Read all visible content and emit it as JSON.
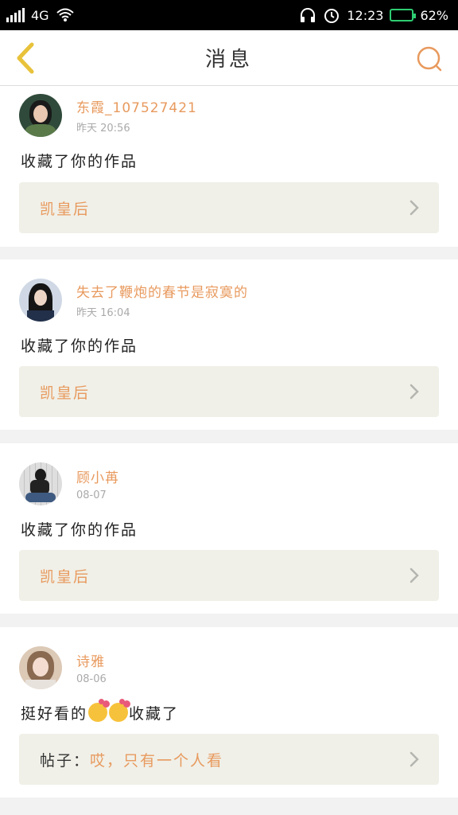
{
  "status_bar": {
    "network": "4G",
    "time": "12:23",
    "battery": "62%",
    "battery_level": 0.62,
    "icons": [
      "signal-icon",
      "wifi-icon",
      "headset-icon",
      "alarm-icon",
      "battery-icon"
    ]
  },
  "header": {
    "title": "消息",
    "back_icon": "chevron-left-icon",
    "search_icon": "search-icon"
  },
  "colors": {
    "accent": "#e89a5e",
    "back_arrow": "#e8c23a",
    "ref_bg": "#f0f0e8"
  },
  "messages": [
    {
      "user": "东霞_107527421",
      "time": "昨天 20:56",
      "text": "收藏了你的作品",
      "ref_prefix": "",
      "ref_title": "凯皇后"
    },
    {
      "user": "失去了鞭炮的春节是寂寞的",
      "time": "昨天 16:04",
      "text": "收藏了你的作品",
      "ref_prefix": "",
      "ref_title": "凯皇后"
    },
    {
      "user": "顾小苒",
      "time": "08-07",
      "text": "收藏了你的作品",
      "ref_prefix": "",
      "ref_title": "凯皇后"
    },
    {
      "user": "诗雅",
      "time": "08-06",
      "text_before": "挺好看的",
      "text_after": "收藏了",
      "ref_prefix": "帖子：",
      "ref_title": "哎，只有一个人看"
    }
  ]
}
